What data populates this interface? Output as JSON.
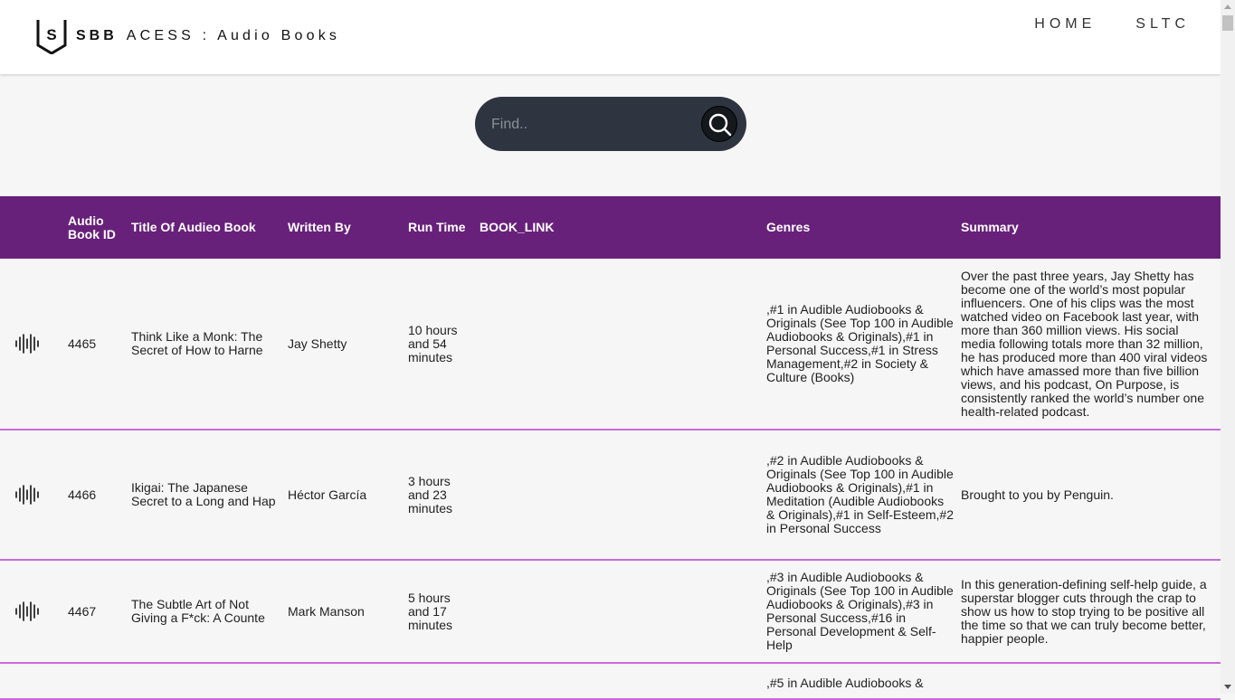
{
  "header": {
    "brand_bold": "SBB",
    "brand_rest": "ACESS : Audio Books",
    "logo_letter": "S",
    "nav": [
      "HOME",
      "SLTC"
    ]
  },
  "search": {
    "placeholder": "Find.."
  },
  "table": {
    "columns": [
      "",
      "Audio Book ID",
      "Title Of Audieo Book",
      "Written By",
      "Run Time",
      "BOOK_LINK",
      "Genres",
      "Summary"
    ],
    "rows": [
      {
        "id": "4465",
        "title": "Think Like a Monk: The Secret of How to Harne",
        "author": "Jay Shetty",
        "runtime": "10 hours and 54 minutes",
        "link": "",
        "genres": ",#1 in Audible Audiobooks & Originals (See Top 100 in Audible Audiobooks & Originals),#1 in Personal Success,#1 in Stress Management,#2 in Society & Culture (Books)",
        "summary": "Over the past three years, Jay Shetty has become one of the world’s most popular influencers. One of his clips was the most watched video on Facebook last year, with more than 360 million views. His social media following totals more than 32 million, he has produced more than 400 viral videos which have amassed more than five billion views, and his podcast, On Purpose, is consistently ranked the world’s number one health-related podcast."
      },
      {
        "id": "4466",
        "title": "Ikigai: The Japanese Secret to a Long and Hap",
        "author": "Héctor García",
        "runtime": "3 hours and 23 minutes",
        "link": "",
        "genres": ",#2 in Audible Audiobooks & Originals (See Top 100 in Audible Audiobooks & Originals),#1 in Meditation (Audible Audiobooks & Originals),#1 in Self-Esteem,#2 in Personal Success",
        "summary": "Brought to you by Penguin."
      },
      {
        "id": "4467",
        "title": "The Subtle Art of Not Giving a F*ck: A Counte",
        "author": "Mark Manson",
        "runtime": "5 hours and 17 minutes",
        "link": "",
        "genres": ",#3 in Audible Audiobooks & Originals (See Top 100 in Audible Audiobooks & Originals),#3 in Personal Success,#16 in Personal Development & Self-Help",
        "summary": "In this generation-defining self-help guide, a superstar blogger cuts through the crap to show us how to stop trying to be positive all the time so that we can truly become better, happier people."
      },
      {
        "id": "",
        "title": "",
        "author": "",
        "runtime": "",
        "link": "",
        "genres": ",#5 in Audible Audiobooks &",
        "summary": ""
      }
    ]
  },
  "icons": {
    "row_icon": "audio-wave-icon",
    "search": "search-icon",
    "logo": "shield-logo-icon"
  },
  "colors": {
    "header_row": "#68217a",
    "row_divider": "#c96dd8",
    "search_bg": "#2f3540"
  }
}
